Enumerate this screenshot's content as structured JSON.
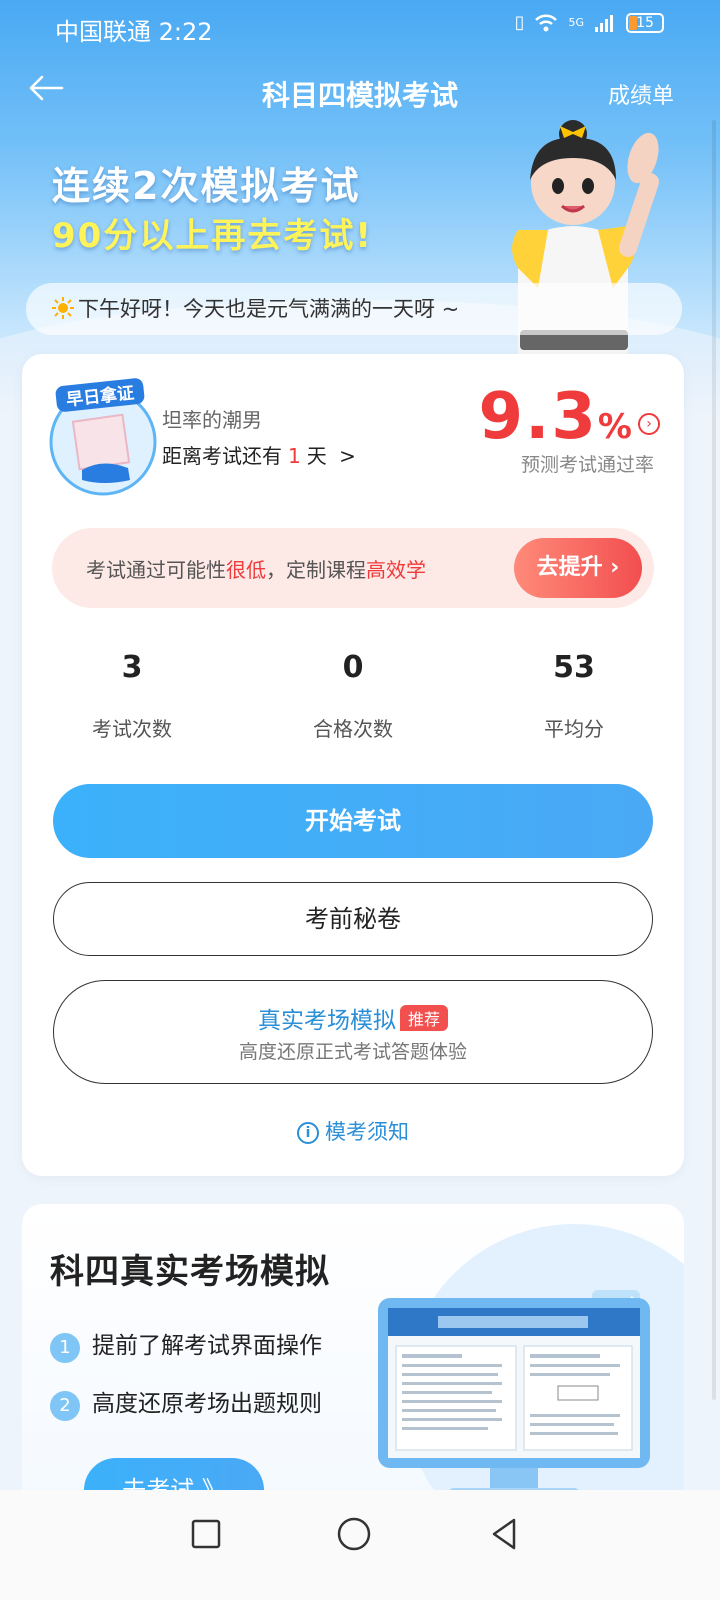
{
  "status_bar": {
    "carrier_time": "中国联通 2:22",
    "network": "5G",
    "battery": "15"
  },
  "header": {
    "title": "科目四模拟考试",
    "right_link": "成绩单"
  },
  "banner": {
    "line1": "连续2次模拟考试",
    "line2": "90分以上再去考试!"
  },
  "greeting": "下午好呀！今天也是元气满满的一天呀 ~",
  "profile": {
    "badge_text": "早日拿证",
    "name": "坦率的潮男",
    "countdown_prefix": "距离考试还有",
    "countdown_days": "1",
    "countdown_suffix": "天",
    "pass_rate": "9.3",
    "pass_rate_unit": "%",
    "pass_rate_label": "预测考试通过率"
  },
  "improve": {
    "text_a": "考试通过可能性",
    "text_b": "很低",
    "text_c": "，定制课程",
    "text_d": "高效学",
    "button": "去提升"
  },
  "stats": [
    {
      "value": "3",
      "label": "考试次数"
    },
    {
      "value": "0",
      "label": "合格次数"
    },
    {
      "value": "53",
      "label": "平均分"
    }
  ],
  "buttons": {
    "start": "开始考试",
    "secret": "考前秘卷",
    "sim_title": "真实考场模拟",
    "sim_tag": "推荐",
    "sim_sub": "高度还原正式考试答题体验",
    "notice": "模考须知"
  },
  "section2": {
    "title": "科四真实考场模拟",
    "features": [
      {
        "num": "1",
        "text": "提前了解考试界面操作"
      },
      {
        "num": "2",
        "text": "高度还原考场出题规则"
      }
    ],
    "go_button": "去考试 》"
  },
  "colors": {
    "accent_blue": "#3cb1fb",
    "alert_red": "#ef3b3b",
    "highlight_yellow": "#fff35a"
  }
}
